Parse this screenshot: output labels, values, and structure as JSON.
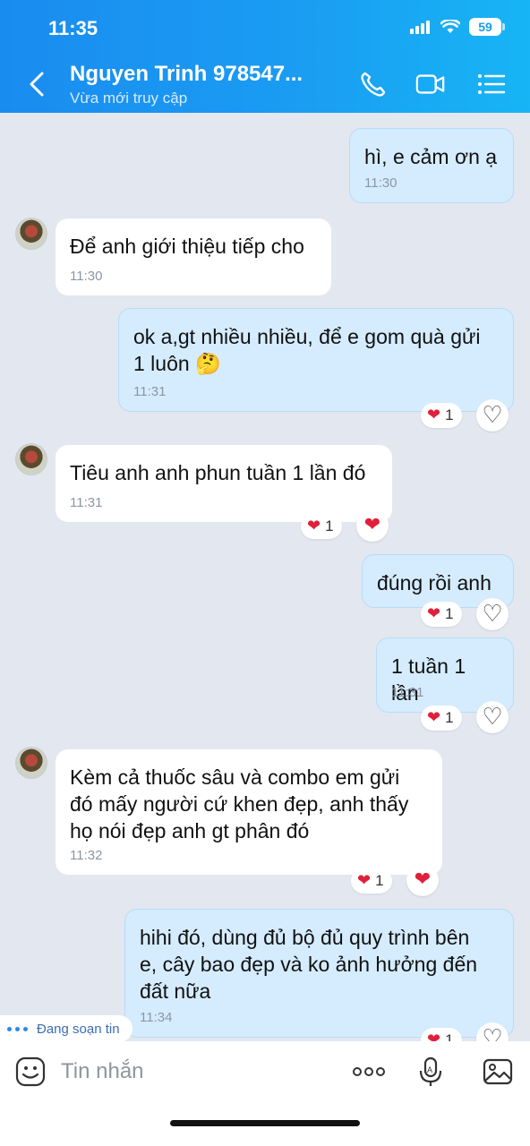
{
  "status_bar": {
    "time": "11:35",
    "battery": "59"
  },
  "header": {
    "contact_name": "Nguyen Trinh 978547...",
    "contact_status": "Vừa mới truy cập",
    "icons": [
      "back-chevron-icon",
      "phone-icon",
      "video-call-icon",
      "menu-list-icon"
    ]
  },
  "messages": [
    {
      "direction": "outgoing",
      "lines": [
        "hì, e cảm ơn ạ"
      ],
      "time": "11:30"
    },
    {
      "direction": "incoming",
      "lines": [
        "Để anh giới thiệu tiếp cho"
      ],
      "time": "11:30"
    },
    {
      "direction": "outgoing",
      "lines": [
        "ok a,gt nhiều nhiều, để e gom quà gửi",
        "1 luôn 🤔"
      ],
      "time": "11:31",
      "reaction": {
        "emoji": "❤️",
        "count": "1"
      }
    },
    {
      "direction": "incoming",
      "lines": [
        "Tiêu anh anh phun tuần 1 lần đó"
      ],
      "time": "11:31",
      "reaction": {
        "emoji": "❤️",
        "count": "1"
      }
    },
    {
      "direction": "outgoing",
      "lines": [
        "đúng rồi anh"
      ],
      "reaction": {
        "emoji": "❤️",
        "count": "1"
      }
    },
    {
      "direction": "outgoing",
      "lines": [
        "1 tuần 1 lần"
      ],
      "time": "11:31",
      "reaction": {
        "emoji": "❤️",
        "count": "1"
      }
    },
    {
      "direction": "incoming",
      "lines": [
        "Kèm cả thuốc sâu và combo em gửi",
        "đó mấy người cứ khen đẹp, anh thấy",
        "họ nói đẹp anh gt phân đó"
      ],
      "time": "11:32",
      "reaction": {
        "emoji": "❤️",
        "count": "1"
      }
    },
    {
      "direction": "outgoing",
      "lines": [
        "hihi đó, dùng đủ bộ đủ quy trình bên",
        "e, cây bao đẹp và ko ảnh hưởng đến",
        "đất nữa"
      ],
      "time": "11:34",
      "reaction": {
        "emoji": "❤️",
        "count": "1"
      }
    }
  ],
  "typing_indicator": "Đang soạn tin",
  "composer": {
    "placeholder": "Tin nhắn",
    "icons": [
      "sticker-icon",
      "more-options-icon",
      "voice-input-icon",
      "image-gallery-icon"
    ]
  },
  "colors": {
    "header_start": "#1a8cf0",
    "header_end": "#17b5f5",
    "outgoing_bubble": "#d5ecff",
    "chat_background": "#e3e7ef",
    "heart": "#e0203a"
  }
}
